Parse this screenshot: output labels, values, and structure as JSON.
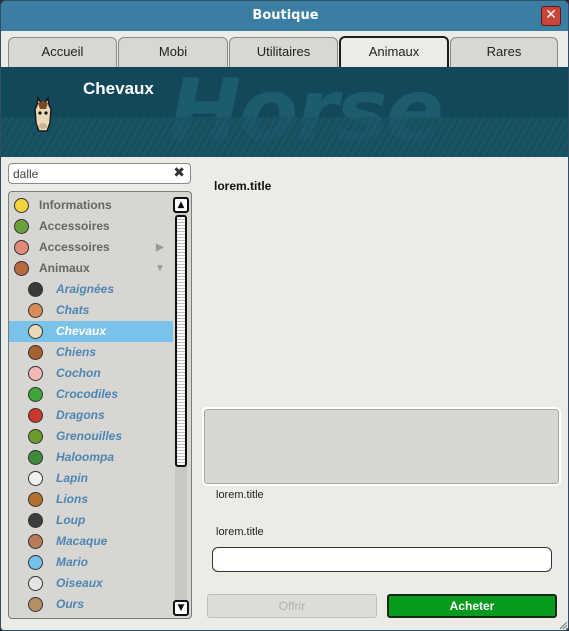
{
  "window": {
    "title": "Boutique",
    "close_symbol": "✕"
  },
  "tabs": [
    {
      "label": "Accueil",
      "active": false
    },
    {
      "label": "Mobi",
      "active": false
    },
    {
      "label": "Utilitaires",
      "active": false
    },
    {
      "label": "Animaux",
      "active": true
    },
    {
      "label": "Rares",
      "active": false
    }
  ],
  "banner": {
    "title": "Chevaux",
    "background_text": "Horse",
    "icon": "horse-head-icon"
  },
  "search": {
    "value": "dalle",
    "clear_symbol": "✖"
  },
  "categories": {
    "top": [
      {
        "label": "Informations",
        "icon": "star-icon",
        "color": "#f2d33a"
      },
      {
        "label": "Accessoires",
        "icon": "cube-icon",
        "color": "#6aa03c"
      },
      {
        "label": "Accessoires",
        "icon": "items-icon",
        "color": "#e38a7a",
        "arrow": "▶"
      },
      {
        "label": "Animaux",
        "icon": "monkey-icon",
        "color": "#b86a3e",
        "arrow": "▼"
      }
    ],
    "sub": [
      {
        "label": "Araignées",
        "icon": "spider-icon",
        "color": "#3a3a3a"
      },
      {
        "label": "Chats",
        "icon": "cat-icon",
        "color": "#d88d57"
      },
      {
        "label": "Chevaux",
        "icon": "horse-icon",
        "color": "#e9d9b6",
        "selected": true
      },
      {
        "label": "Chiens",
        "icon": "dog-icon",
        "color": "#a5622f"
      },
      {
        "label": "Cochon",
        "icon": "pig-icon",
        "color": "#f3b8b8"
      },
      {
        "label": "Crocodiles",
        "icon": "crocodile-icon",
        "color": "#3fa53a"
      },
      {
        "label": "Dragons",
        "icon": "dragon-icon",
        "color": "#c8392b"
      },
      {
        "label": "Grenouilles",
        "icon": "frog-icon",
        "color": "#6c9a2e"
      },
      {
        "label": "Haloompa",
        "icon": "haloompa-icon",
        "color": "#3c8a3c"
      },
      {
        "label": "Lapin",
        "icon": "rabbit-icon",
        "color": "#f1f1f1"
      },
      {
        "label": "Lions",
        "icon": "lion-icon",
        "color": "#b5702e"
      },
      {
        "label": "Loup",
        "icon": "wolf-icon",
        "color": "#3c3c3c"
      },
      {
        "label": "Macaque",
        "icon": "macaque-icon",
        "color": "#b87a58"
      },
      {
        "label": "Mario",
        "icon": "mario-icon",
        "color": "#73c2ec"
      },
      {
        "label": "Oiseaux",
        "icon": "bird-icon",
        "color": "#e4e4e4"
      },
      {
        "label": "Ours",
        "icon": "bear-icon",
        "color": "#b58f63"
      }
    ]
  },
  "scroll": {
    "up_symbol": "▲",
    "down_symbol": "▼"
  },
  "product": {
    "title": "lorem.title",
    "price_label": "lorem.title",
    "gift_label": "lorem.title",
    "gift_value": ""
  },
  "buttons": {
    "offer": "Offrir",
    "buy": "Acheter"
  },
  "colors": {
    "accent": "#3a7fa3",
    "selection": "#79c3ea",
    "buy": "#089a1c"
  }
}
